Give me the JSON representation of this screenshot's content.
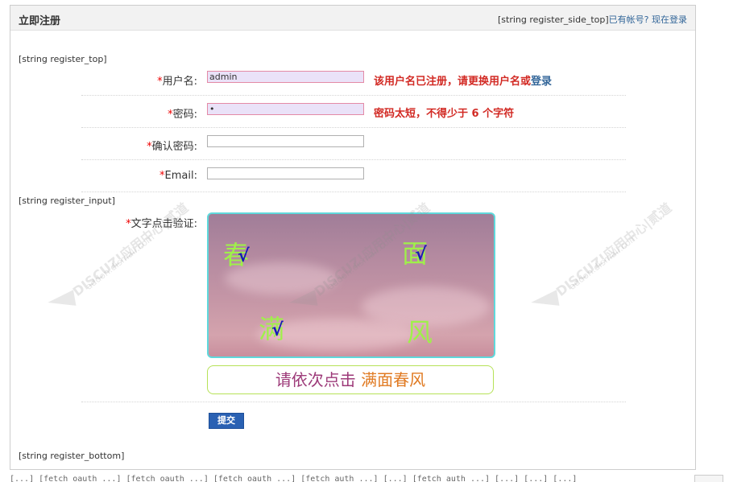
{
  "header": {
    "title": "立即注册",
    "side_hook": "[string register_side_top]",
    "has_account": "已有帐号?",
    "login_now": "现在登录"
  },
  "hooks": {
    "top": "[string register_top]",
    "input": "[string register_input]",
    "bottom": "[string register_bottom]"
  },
  "fields": {
    "username": {
      "required": "*",
      "label": "用户名:",
      "value": "admin",
      "error": "该用户名已注册，请更换用户名或",
      "error_link": "登录"
    },
    "password": {
      "required": "*",
      "label": "密码:",
      "value": "•",
      "error": "密码太短，不得少于 6 个字符"
    },
    "confirm": {
      "required": "*",
      "label": "确认密码:",
      "value": ""
    },
    "email": {
      "required": "*",
      "label": "Email:",
      "value": ""
    }
  },
  "captcha": {
    "required": "*",
    "label": "文字点击验证:",
    "chars": [
      "春",
      "面",
      "满",
      "风"
    ],
    "tick": "√",
    "prompt_prefix": "请依次点击 ",
    "prompt_target": "满面春风"
  },
  "submit_label": "提交",
  "watermark": {
    "line1": "DISCUZ!应用中心|贰道",
    "line2": "addon.dismall.com"
  },
  "footer_text": "[...] [fetch_oauth_...] [fetch_oauth_...] [fetch_oauth_...] [fetch_auth_...] [...] [fetch_auth_...] [...] [...] [...]"
}
